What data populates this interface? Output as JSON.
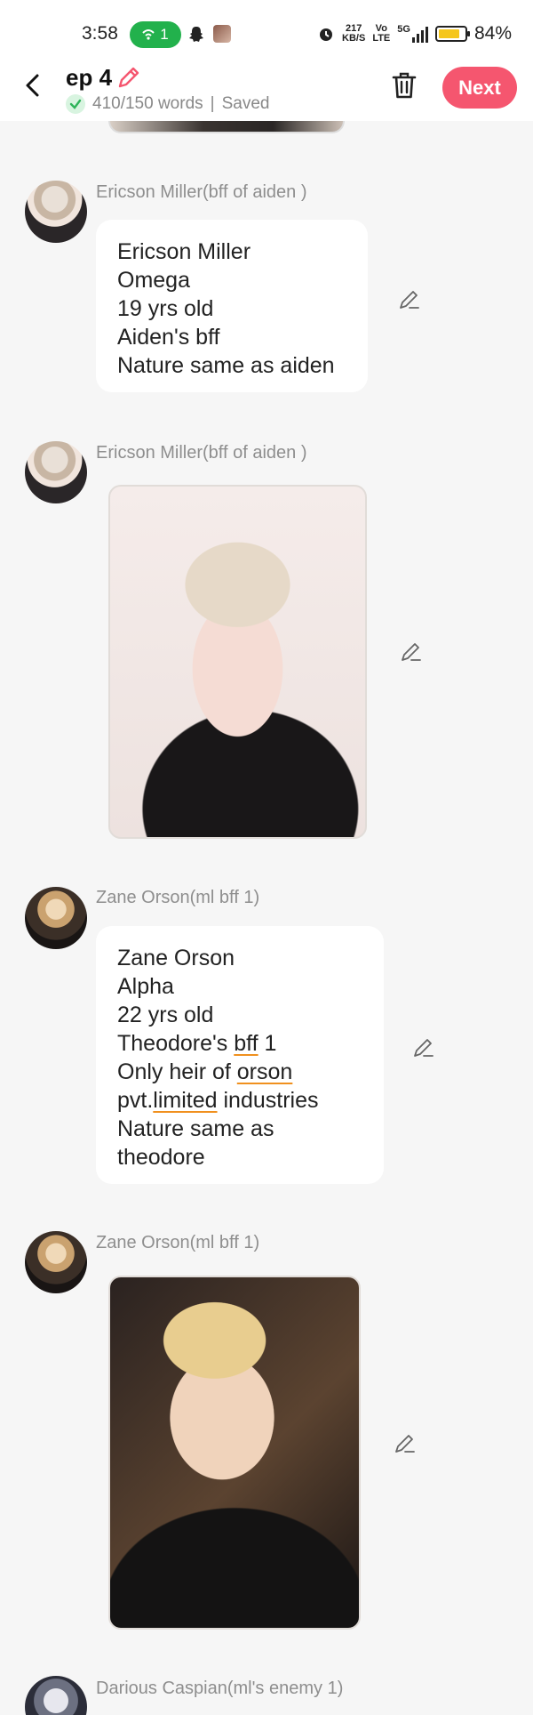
{
  "status_bar": {
    "time": "3:58",
    "hotspot_count": "1",
    "net_speed_top": "217",
    "net_speed_bottom": "KB/S",
    "volte_top": "Vo",
    "volte_bottom": "LTE",
    "signal_label": "5G",
    "battery": "84%"
  },
  "header": {
    "title": "ep 4",
    "word_count": "410/150 words",
    "separator": "|",
    "save_status": "Saved",
    "next_label": "Next"
  },
  "messages": [
    {
      "name": "Ericson Miller(bff of aiden )",
      "lines": [
        "Ericson Miller",
        "Omega",
        "19 yrs old",
        "Aiden's bff",
        "Nature same as aiden"
      ]
    },
    {
      "name": "Ericson Miller(bff of aiden )",
      "image_desc": "ericson-portrait"
    },
    {
      "name": "Zane Orson(ml bff 1)",
      "lines": [
        "Zane Orson",
        "Alpha",
        "22 yrs old",
        "Theodore's ",
        "bff",
        " 1",
        "Only heir of ",
        "orson",
        "pvt.",
        "limited",
        " industries",
        "Nature same as",
        "theodore"
      ]
    },
    {
      "name": "Zane Orson(ml bff 1)",
      "image_desc": "zane-portrait"
    },
    {
      "name": "Darious Caspian(ml's enemy 1)"
    }
  ],
  "colors": {
    "accent": "#f5566f",
    "hotspot": "#22b14c",
    "battery": "#f5c61b",
    "underline": "#f0901e"
  }
}
